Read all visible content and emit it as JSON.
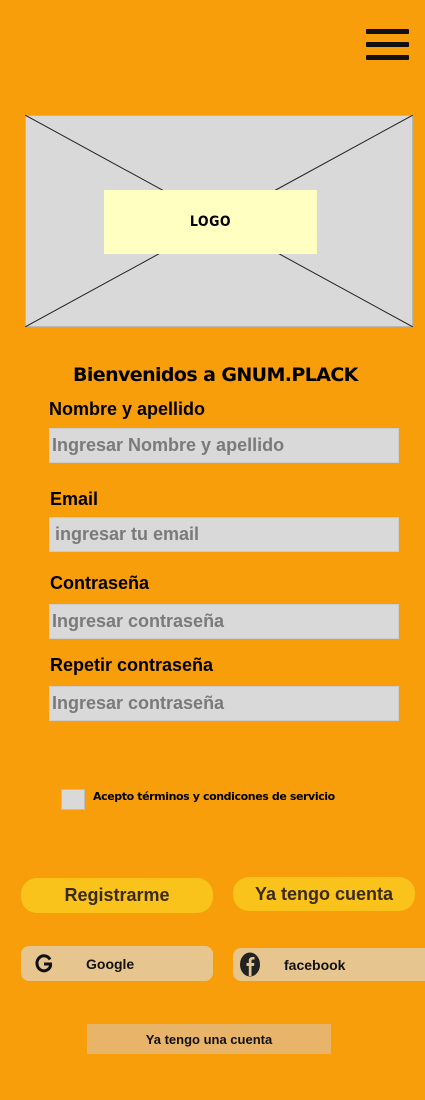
{
  "header": {
    "menu_icon": "hamburger-menu-icon"
  },
  "logo": {
    "label": "LOGO"
  },
  "form": {
    "heading": "Bienvenidos a GNUM.PLACK",
    "fields": [
      {
        "label": "Nombre y apellido",
        "placeholder": "Ingresar Nombre y apellido",
        "value": ""
      },
      {
        "label": "Email",
        "placeholder": "ingresar tu email",
        "value": ""
      },
      {
        "label": "Contraseña",
        "placeholder": "Ingresar contraseña",
        "value": ""
      },
      {
        "label": "Repetir contraseña",
        "placeholder": "Ingresar contraseña",
        "value": ""
      }
    ],
    "terms": {
      "label": "Acepto términos y condicones de servicio",
      "checked": false
    }
  },
  "actions": {
    "register": "Registrarme",
    "have_account": "Ya tengo cuenta"
  },
  "social": {
    "google": {
      "label": "Google",
      "icon": "google-icon"
    },
    "facebook": {
      "label": "facebook",
      "icon": "facebook-icon"
    }
  },
  "footer": {
    "link": "Ya tengo una cuenta"
  }
}
